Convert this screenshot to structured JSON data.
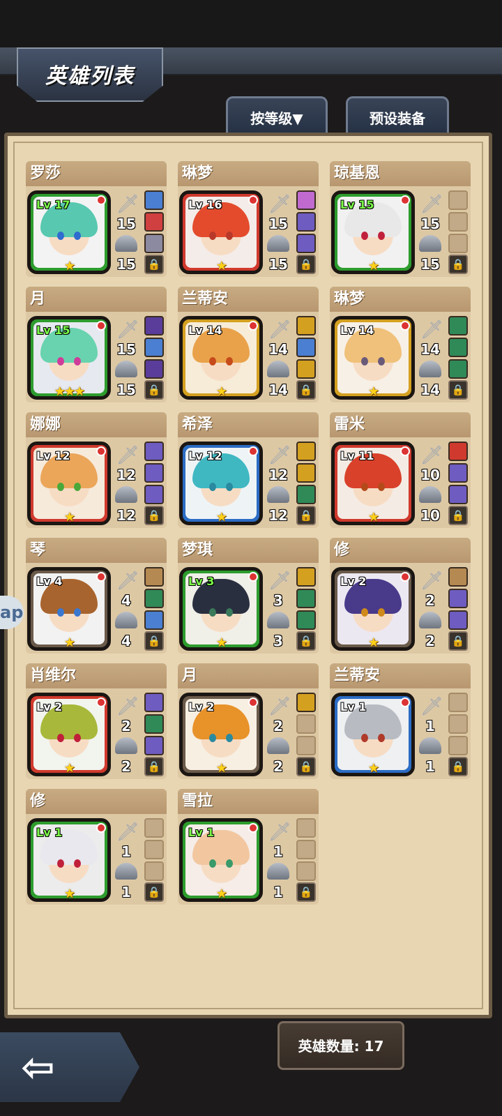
{
  "header": {
    "title": "英雄列表"
  },
  "buttons": {
    "sort_label": "按等级▼",
    "preset_label": "预设装备"
  },
  "footer": {
    "count_text": "英雄数量: 17",
    "back_icon": "back-arrow-icon"
  },
  "side_handle": {
    "label": "ap"
  },
  "heroes": [
    {
      "name": "罗莎",
      "level": "Lv 17",
      "stars": "★",
      "attack": "15",
      "defense": "15",
      "frame": "#2d9c2d",
      "hair": "#58c8b0",
      "eye": "#2f6ccf",
      "bg": "#f3f3f3",
      "slots": [
        "#4a7fd1",
        "#d04040",
        "#8c8aa0"
      ]
    },
    {
      "name": "琳梦",
      "level": "Lv 16",
      "stars": "★",
      "attack": "15",
      "defense": "15",
      "frame": "#d0392d",
      "hair": "#e44b2d",
      "eye": "#b8392a",
      "bg": "#f4ece8",
      "slots": [
        "#c06ad0",
        "#6e5cc0",
        "#6e5cc0"
      ]
    },
    {
      "name": "琼基恩",
      "level": "Lv 15",
      "stars": "★",
      "attack": "15",
      "defense": "15",
      "frame": "#2d9c2d",
      "hair": "#e8e8e8",
      "eye": "#c0203a",
      "bg": "#f1f1f1",
      "slots": [
        "",
        "",
        ""
      ]
    },
    {
      "name": "月",
      "level": "Lv 15",
      "stars": "★★★",
      "attack": "15",
      "defense": "15",
      "frame": "#2d9c2d",
      "hair": "#68d3ae",
      "eye": "#d03c9a",
      "bg": "#e6e9f0",
      "slots": [
        "#5a3d9a",
        "#4a7fd1",
        "#5a3d9a"
      ]
    },
    {
      "name": "兰蒂安",
      "level": "Lv 14",
      "stars": "★",
      "attack": "14",
      "defense": "14",
      "frame": "#d4a020",
      "hair": "#e9a24a",
      "eye": "#c64a1a",
      "bg": "#f7ecd8",
      "slots": [
        "#d4a020",
        "#4a7fd1",
        "#d4a020"
      ]
    },
    {
      "name": "琳梦",
      "level": "Lv 14",
      "stars": "★",
      "attack": "14",
      "defense": "14",
      "frame": "#d4a020",
      "hair": "#f0c17a",
      "eye": "#6a5a7a",
      "bg": "#f7f0e6",
      "slots": [
        "#2f8a58",
        "#2f8a58",
        "#2f8a58"
      ]
    },
    {
      "name": "娜娜",
      "level": "Lv 12",
      "stars": "★",
      "attack": "12",
      "defense": "12",
      "frame": "#d0392d",
      "hair": "#eba65a",
      "eye": "#4aa83a",
      "bg": "#f6eadb",
      "slots": [
        "#6e5cc0",
        "#6e5cc0",
        "#6e5cc0"
      ]
    },
    {
      "name": "希泽",
      "level": "Lv 12",
      "stars": "★",
      "attack": "12",
      "defense": "12",
      "frame": "#2b6cc4",
      "hair": "#3fb8c2",
      "eye": "#2a8aa0",
      "bg": "#eef4f6",
      "slots": [
        "#d4a020",
        "#d4a020",
        "#2f8a58"
      ]
    },
    {
      "name": "雷米",
      "level": "Lv 11",
      "stars": "★",
      "attack": "10",
      "defense": "10",
      "frame": "#d0392d",
      "hair": "#d9412a",
      "eye": "#b44a1a",
      "bg": "#f4ece4",
      "slots": [
        "#d0392d",
        "#6e5cc0",
        "#6e5cc0"
      ]
    },
    {
      "name": "琴",
      "level": "Lv 4",
      "stars": "★",
      "attack": "4",
      "defense": "4",
      "frame": "#6a5a4a",
      "hair": "#a8642e",
      "eye": "#3a78d0",
      "bg": "#f2f2f2",
      "slots": [
        "#b58a52",
        "#2f8a58",
        "#4a7fd1"
      ]
    },
    {
      "name": "梦琪",
      "level": "Lv 3",
      "stars": "★",
      "attack": "3",
      "defense": "3",
      "frame": "#2d9c2d",
      "hair": "#2a2f40",
      "eye": "#3a7a5a",
      "bg": "#f0efe8",
      "slots": [
        "#d4a020",
        "#2f8a58",
        "#2f8a58"
      ]
    },
    {
      "name": "修",
      "level": "Lv 2",
      "stars": "★",
      "attack": "2",
      "defense": "2",
      "frame": "#6a5a4a",
      "hair": "#4a3a8a",
      "eye": "#d08a1a",
      "bg": "#ece8f2",
      "slots": [
        "#b58a52",
        "#6e5cc0",
        "#6e5cc0"
      ]
    },
    {
      "name": "肖维尔",
      "level": "Lv 2",
      "stars": "★",
      "attack": "2",
      "defense": "2",
      "frame": "#d0392d",
      "hair": "#a8b83a",
      "eye": "#c0203a",
      "bg": "#f2f4ee",
      "slots": [
        "#6e5cc0",
        "#2f8a58",
        "#6e5cc0"
      ]
    },
    {
      "name": "月",
      "level": "Lv 2",
      "stars": "★",
      "attack": "2",
      "defense": "2",
      "frame": "#6a5a4a",
      "hair": "#e8922a",
      "eye": "#2a8aa0",
      "bg": "#f7efe2",
      "slots": [
        "#d4a020",
        "",
        ""
      ]
    },
    {
      "name": "兰蒂安",
      "level": "Lv 1",
      "stars": "★",
      "attack": "1",
      "defense": "1",
      "frame": "#2b6cc4",
      "hair": "#b8bcc2",
      "eye": "#b03a2a",
      "bg": "#eef0f2",
      "slots": [
        "",
        "",
        ""
      ]
    },
    {
      "name": "修",
      "level": "Lv 1",
      "stars": "★",
      "attack": "1",
      "defense": "1",
      "frame": "#2d9c2d",
      "hair": "#e8e8ee",
      "eye": "#c0203a",
      "bg": "#ececec",
      "slots": [
        "",
        "",
        ""
      ]
    },
    {
      "name": "雪拉",
      "level": "Lv 1",
      "stars": "★",
      "attack": "1",
      "defense": "1",
      "frame": "#2d9c2d",
      "hair": "#f2c7a0",
      "eye": "#3a9a6a",
      "bg": "#f6ede8",
      "slots": [
        "",
        "",
        ""
      ]
    }
  ]
}
